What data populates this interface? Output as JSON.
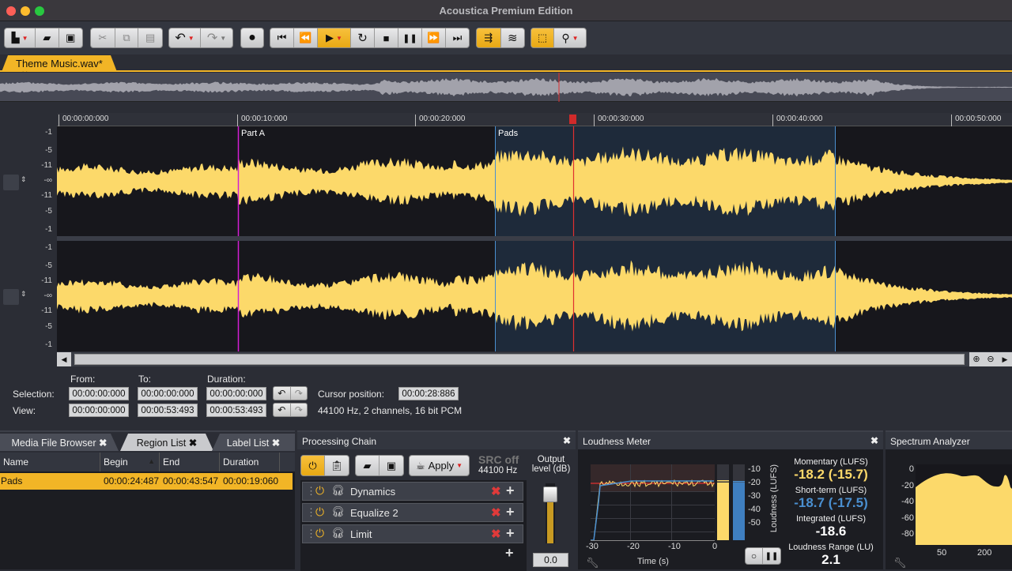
{
  "window": {
    "title": "Acoustica Premium Edition"
  },
  "toolbar": {
    "groups": [
      {
        "name": "file",
        "buttons": [
          "new-file",
          "open",
          "save"
        ]
      },
      {
        "name": "edit",
        "buttons": [
          "cut",
          "copy",
          "paste"
        ]
      },
      {
        "name": "history",
        "buttons": [
          "undo",
          "redo"
        ]
      },
      {
        "name": "record",
        "buttons": [
          "record"
        ]
      },
      {
        "name": "transport",
        "buttons": [
          "go-to-start",
          "rewind",
          "play",
          "loop",
          "stop",
          "pause",
          "fast-forward",
          "go-to-end"
        ]
      },
      {
        "name": "view",
        "buttons": [
          "scrub",
          "spectral-view"
        ]
      },
      {
        "name": "tools",
        "buttons": [
          "select-tool",
          "zoom-tool"
        ]
      }
    ],
    "glyphs": {
      "new": "▙",
      "open": "▰",
      "save": "▣",
      "cut": "✂",
      "copy": "⧉",
      "paste": "▤",
      "undo": "↶",
      "redo": "↷",
      "record": "●",
      "start": "⏮",
      "rewind": "⏪",
      "play": "▶",
      "loop": "↻",
      "stop": "■",
      "pause": "❚❚",
      "ff": "⏩",
      "end": "⏭",
      "scrub": "⇶",
      "spectral": "≋",
      "select": "⬚",
      "zoom": "⚲",
      "dropdown": "▼"
    }
  },
  "file_tab": {
    "label": "Theme Music.wav*",
    "close": "✖"
  },
  "ruler": {
    "ticks": [
      "00:00:00:000",
      "00:00:10:000",
      "00:00:20:000",
      "00:00:30:000",
      "00:00:40:000",
      "00:00:50:000"
    ]
  },
  "waveform": {
    "amplitude_labels": [
      "-1",
      "-5",
      "-11",
      "-∞",
      "-11",
      "-5",
      "-1"
    ],
    "regions": [
      {
        "label": "Part A",
        "color": "#d21fd2"
      },
      {
        "label": "Pads",
        "color": "#4a8fd0"
      }
    ],
    "cursor_color": "#e03030",
    "wave_color": "#fcd96a",
    "selected_wave_color": "#d8c97e",
    "selection_bg": "#1e2a3a"
  },
  "selection_info": {
    "headers": {
      "from": "From:",
      "to": "To:",
      "duration": "Duration:"
    },
    "selection_label": "Selection:",
    "view_label": "View:",
    "selection": {
      "from": "00:00:00:000",
      "to": "00:00:00:000",
      "duration": "00:00:00:000"
    },
    "view": {
      "from": "00:00:00:000",
      "to": "00:00:53:493",
      "duration": "00:00:53:493"
    },
    "cursor_label": "Cursor position:",
    "cursor_value": "00:00:28:886",
    "format": "44100 Hz, 2 channels, 16 bit PCM"
  },
  "left_panel": {
    "tabs": [
      {
        "label": "Media File Browser",
        "active": false
      },
      {
        "label": "Region List",
        "active": true
      },
      {
        "label": "Label List",
        "active": false
      }
    ],
    "columns": [
      "Name",
      "Begin",
      "End",
      "Duration"
    ],
    "rows": [
      {
        "name": "Pads",
        "begin": "00:00:24:487",
        "end": "00:00:43:547",
        "duration": "00:00:19:060"
      }
    ]
  },
  "processing_chain": {
    "title": "Processing Chain",
    "apply_label": "Apply",
    "src_status": "SRC off",
    "src_rate": "44100 Hz",
    "output_label_1": "Output",
    "output_label_2": "level (dB)",
    "output_value": "0.0",
    "output_level_fraction": 0.82,
    "effects": [
      {
        "name": "Dynamics"
      },
      {
        "name": "Equalize 2"
      },
      {
        "name": "Limit"
      }
    ]
  },
  "loudness_meter": {
    "title": "Loudness Meter",
    "x_ticks": [
      "-30",
      "-20",
      "-10",
      "0"
    ],
    "x_label": "Time (s)",
    "y_ticks": [
      "-10",
      "-20",
      "-30",
      "-40",
      "-50"
    ],
    "y_label": "Loudness (LUFS)",
    "momentary_label": "Momentary (LUFS)",
    "momentary_value": "-18.2 (-15.7)",
    "shortterm_label": "Short-term (LUFS)",
    "shortterm_value": "-18.7 (-17.5)",
    "integrated_label": "Integrated (LUFS)",
    "integrated_value": "-18.6",
    "range_label": "Loudness Range (LU)",
    "range_value": "2.1",
    "colors": {
      "momentary": "#fcd96a",
      "shortterm": "#4a8fd0",
      "target": "#e03030"
    }
  },
  "spectrum_analyzer": {
    "title": "Spectrum Analyzer",
    "y_ticks": [
      "0",
      "-20",
      "-40",
      "-60",
      "-80"
    ],
    "x_ticks": [
      "50",
      "200"
    ]
  }
}
